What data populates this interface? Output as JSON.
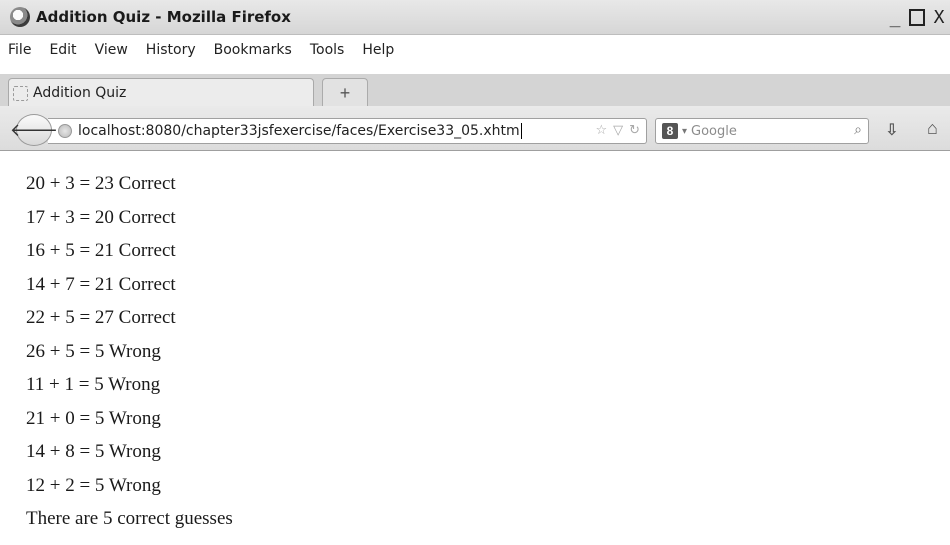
{
  "window": {
    "title": "Addition Quiz - Mozilla Firefox",
    "controls": {
      "minimize": "_",
      "close": "X"
    }
  },
  "menu": [
    "File",
    "Edit",
    "View",
    "History",
    "Bookmarks",
    "Tools",
    "Help"
  ],
  "tab": {
    "label": "Addition Quiz",
    "new_tab_label": "+"
  },
  "navbar": {
    "url": "localhost:8080/chapter33jsfexercise/faces/Exercise33_05.xhtm",
    "search_engine_letter": "8",
    "search_placeholder": "Google"
  },
  "icons": {
    "app": "firefox-icon",
    "back": "back-arrow-icon",
    "site": "site-identity-icon",
    "bookmark": "star-icon",
    "history": "dropmarker-icon",
    "reload": "reload-icon",
    "search_go": "magnifier-icon",
    "download": "download-icon",
    "home": "home-icon"
  },
  "content": {
    "lines": [
      "20 + 3 = 23 Correct",
      "17 + 3 = 20 Correct",
      "16 + 5 = 21 Correct",
      "14 + 7 = 21 Correct",
      "22 + 5 = 27 Correct",
      "26 + 5 = 5 Wrong",
      "11 + 1 = 5 Wrong",
      "21 + 0 = 5 Wrong",
      "14 + 8 = 5 Wrong",
      "12 + 2 = 5 Wrong",
      "There are 5 correct guesses"
    ]
  }
}
